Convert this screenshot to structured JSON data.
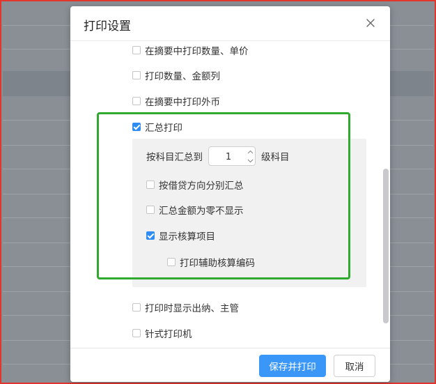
{
  "dialog": {
    "title": "打印设置"
  },
  "options": {
    "print_qty_price_in_summary": {
      "label": "在摘要中打印数量、单价",
      "checked": false
    },
    "print_qty_amount_columns": {
      "label": "打印数量、金额列",
      "checked": false
    },
    "print_foreign_currency_in_summary": {
      "label": "在摘要中打印外币",
      "checked": false
    },
    "summary_print": {
      "label": "汇总打印",
      "checked": true
    },
    "show_cashier_supervisor": {
      "label": "打印时显示出纳、主管",
      "checked": false
    },
    "dot_matrix_printer": {
      "label": "针式打印机",
      "checked": false
    }
  },
  "summary_panel": {
    "level_prefix": "按科目汇总到",
    "level_value": "1",
    "level_suffix": "级科目",
    "split_by_direction": {
      "label": "按借贷方向分别汇总",
      "checked": false
    },
    "hide_zero_amount": {
      "label": "汇总金额为零不显示",
      "checked": false
    },
    "show_accounting_items": {
      "label": "显示核算项目",
      "checked": true
    },
    "print_auxiliary_codes": {
      "label": "打印辅助核算编码",
      "checked": false
    }
  },
  "footer": {
    "save_print_label": "保存并打印",
    "cancel_label": "取消"
  },
  "colors": {
    "accent": "#2f8cf5",
    "highlight_border": "#2faa2f",
    "frame_border": "#e0362c"
  }
}
